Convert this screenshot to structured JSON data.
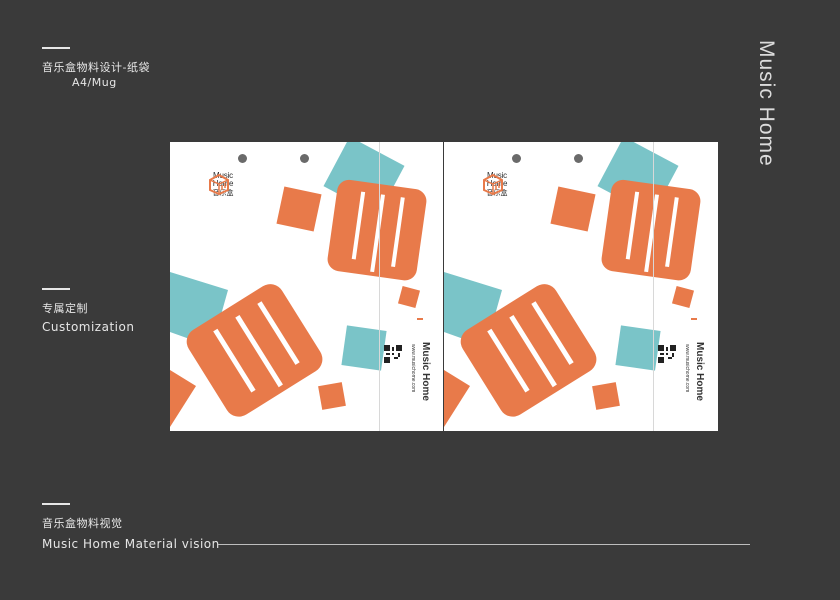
{
  "header": {
    "title_cn": "音乐盒物料设计-纸袋",
    "subtitle": "A4/Mug"
  },
  "vertical_title": "Music Home",
  "section1": {
    "title_cn": "专属定制",
    "title_en": "Customization"
  },
  "section2": {
    "title_cn": "音乐盒物料视觉",
    "title_en": "Music Home Material vision"
  },
  "bag": {
    "logo_line1": "Music",
    "logo_line2": "Home",
    "logo_cn": "音乐盒",
    "side_brand": "Music Home",
    "side_url": "www.musichome.com"
  },
  "colors": {
    "background": "#3a3a3a",
    "orange": "#e87a4a",
    "teal": "#7ac4c8",
    "paper": "#ffffff"
  }
}
